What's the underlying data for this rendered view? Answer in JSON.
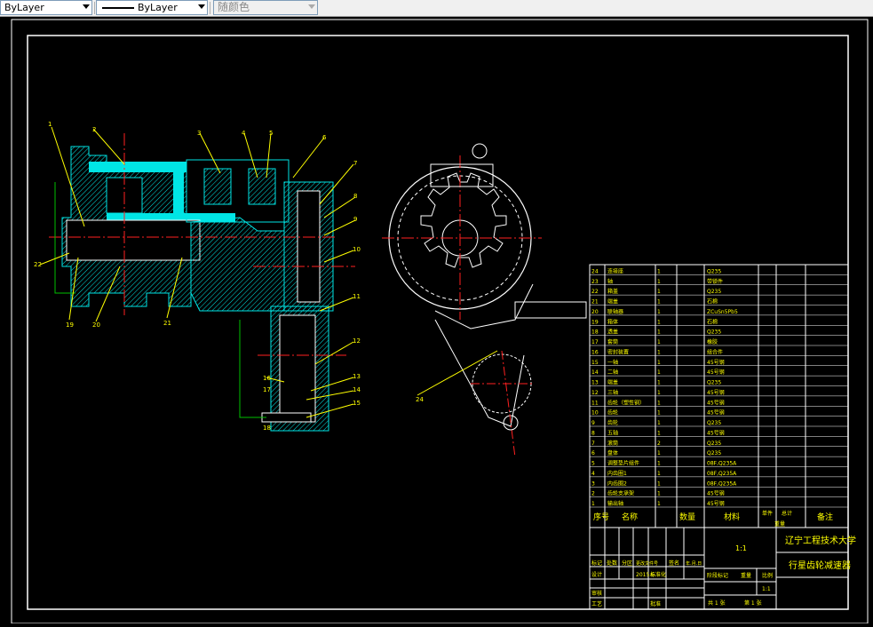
{
  "toolbar": {
    "color_combo": "ByLayer",
    "linetype_combo": "ByLayer",
    "plotstyle_combo": "随颜色"
  },
  "drawing": {
    "balloons_left": [
      "1",
      "2",
      "3",
      "4",
      "5",
      "6",
      "7",
      "8",
      "9",
      "10",
      "11",
      "12",
      "13",
      "14",
      "15",
      "16",
      "17",
      "18",
      "19",
      "20",
      "21",
      "22"
    ],
    "balloon_right": "24",
    "bom_rows": [
      {
        "no": "24",
        "name": "连接座",
        "qty": "1",
        "material": "Q235"
      },
      {
        "no": "23",
        "name": "轴",
        "qty": "1",
        "material": "带锁件"
      },
      {
        "no": "22",
        "name": "箱盖",
        "qty": "1",
        "material": "Q235"
      },
      {
        "no": "21",
        "name": "端盖",
        "qty": "1",
        "material": "石棉"
      },
      {
        "no": "20",
        "name": "联轴器",
        "qty": "1",
        "material": "ZCuSn5Pb5"
      },
      {
        "no": "19",
        "name": "箱体",
        "qty": "1",
        "material": "石棉"
      },
      {
        "no": "18",
        "name": "透盖",
        "qty": "1",
        "material": "Q235"
      },
      {
        "no": "17",
        "name": "套筒",
        "qty": "1",
        "material": "橡胶"
      },
      {
        "no": "16",
        "name": "密封装置",
        "qty": "1",
        "material": "组合件"
      },
      {
        "no": "15",
        "name": "一轴",
        "qty": "1",
        "material": "45号钢"
      },
      {
        "no": "14",
        "name": "二轴",
        "qty": "1",
        "material": "45号钢"
      },
      {
        "no": "13",
        "name": "端盖",
        "qty": "1",
        "material": "Q235"
      },
      {
        "no": "12",
        "name": "三轴",
        "qty": "1",
        "material": "45号钢"
      },
      {
        "no": "11",
        "name": "齿轮（塑性钢）",
        "qty": "1",
        "material": "45号钢"
      },
      {
        "no": "10",
        "name": "齿轮",
        "qty": "1",
        "material": "45号钢"
      },
      {
        "no": "9",
        "name": "齿轮",
        "qty": "1",
        "material": "Q235"
      },
      {
        "no": "8",
        "name": "五轴",
        "qty": "1",
        "material": "45号钢"
      },
      {
        "no": "7",
        "name": "滚筒",
        "qty": "2",
        "material": "Q235"
      },
      {
        "no": "6",
        "name": "盘体",
        "qty": "1",
        "material": "Q235"
      },
      {
        "no": "5",
        "name": "调整垫片组件",
        "qty": "1",
        "material": "08F,Q235A"
      },
      {
        "no": "4",
        "name": "内齿圈1",
        "qty": "1",
        "material": "08F,Q235A"
      },
      {
        "no": "3",
        "name": "内齿圈2",
        "qty": "1",
        "material": "08F,Q235A"
      },
      {
        "no": "2",
        "name": "齿轮支承架",
        "qty": "1",
        "material": "45号钢"
      },
      {
        "no": "1",
        "name": "输出轴",
        "qty": "1",
        "material": "45号钢"
      }
    ],
    "bom_header": {
      "no": "序号",
      "name": "名称",
      "qty": "数量",
      "material": "材料",
      "unit_weight": "单件",
      "total_weight": "总计",
      "weight": "重量",
      "remark": "备注"
    },
    "title_block": {
      "company": "辽宁工程技术大学",
      "drawing_title": "行星齿轮减速器",
      "scale_mark": "1:1",
      "design_label": "设计",
      "check_label": "审核",
      "process_label": "工艺",
      "approve_label": "批准",
      "mark_label": "标记",
      "count_label": "处数",
      "zone_label": "分区",
      "change_label": "更改文件号",
      "sign_label": "签名",
      "date_label": "年.月.日",
      "standard_label": "标准化",
      "stage_label": "阶段标记",
      "weight_label": "重量",
      "ratio_label": "比例",
      "ratio_value": "1:1",
      "total_sheets": "共 1 张",
      "sheet_no": "第 1 张",
      "date_value": "2015.6"
    }
  },
  "colors": {
    "background": "#000000",
    "frame": "#ffffff",
    "section": "#00e5e5",
    "centerline": "#ff2020",
    "text_yellow": "#ffff00",
    "dim_green": "#00c000"
  }
}
